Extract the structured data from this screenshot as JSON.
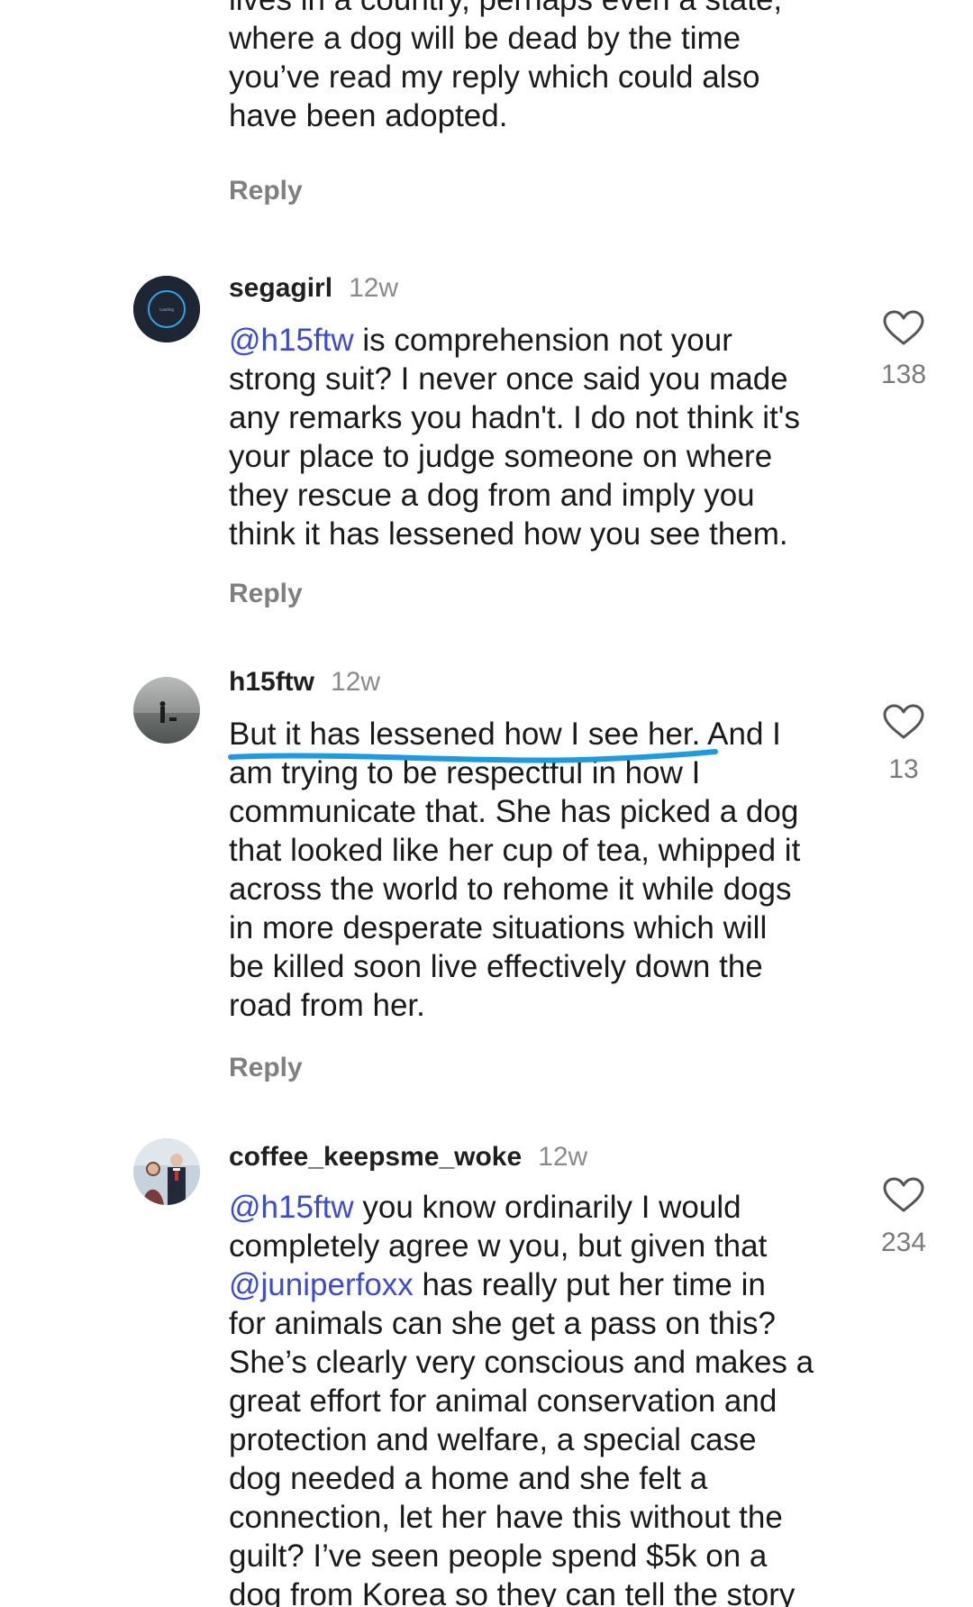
{
  "comments": [
    {
      "lines": [
        [
          {
            "t": "lives in a country, perhaps even a state,"
          }
        ],
        [
          {
            "t": "where a dog will be dead by the time"
          }
        ],
        [
          {
            "t": "you’ve read my reply which could also"
          }
        ],
        [
          {
            "t": "have been adopted."
          }
        ]
      ],
      "reply": "Reply"
    },
    {
      "user": "segagirl",
      "time": "12w",
      "avatar_icon": "loading-avatar-icon",
      "likes": "138",
      "lines": [
        [
          {
            "t": "@h15ftw",
            "m": true
          },
          {
            "t": " is comprehension not your"
          }
        ],
        [
          {
            "t": "strong suit? I never once said you made"
          }
        ],
        [
          {
            "t": "any remarks you hadn't. I do not think it's"
          }
        ],
        [
          {
            "t": "your place to judge someone on where"
          }
        ],
        [
          {
            "t": "they rescue a dog from and imply you"
          }
        ],
        [
          {
            "t": "think it has lessened how you see them."
          }
        ]
      ],
      "reply": "Reply"
    },
    {
      "user": "h15ftw",
      "time": "12w",
      "avatar_icon": "beach-silhouette-avatar",
      "likes": "13",
      "lines": [
        [
          {
            "t": "But it has lessened how I see her. And I"
          }
        ],
        [
          {
            "t": "am trying to be respectful in how I"
          }
        ],
        [
          {
            "t": "communicate that. She has picked a dog"
          }
        ],
        [
          {
            "t": "that looked like her cup of tea, whipped it"
          }
        ],
        [
          {
            "t": "across the world to rehome it while dogs"
          }
        ],
        [
          {
            "t": "in more desperate situations which will"
          }
        ],
        [
          {
            "t": "be killed soon live effectively down the"
          }
        ],
        [
          {
            "t": "road from her."
          }
        ]
      ],
      "reply": "Reply"
    },
    {
      "user": "coffee_keepsme_woke",
      "time": "12w",
      "avatar_icon": "couple-photo-avatar",
      "likes": "234",
      "lines": [
        [
          {
            "t": "@h15ftw",
            "m": true
          },
          {
            "t": " you know ordinarily I would"
          }
        ],
        [
          {
            "t": "completely agree w you, but given that"
          }
        ],
        [
          {
            "t": "@juniperfoxx",
            "m": true
          },
          {
            "t": " has really put her time in"
          }
        ],
        [
          {
            "t": "for animals can she get a pass on this?"
          }
        ],
        [
          {
            "t": "She’s clearly very conscious and makes a"
          }
        ],
        [
          {
            "t": "great effort for animal conservation and"
          }
        ],
        [
          {
            "t": "protection and welfare, a special case"
          }
        ],
        [
          {
            "t": "dog needed a home and she felt a"
          }
        ],
        [
          {
            "t": "connection, let her have this without the"
          }
        ],
        [
          {
            "t": "guilt? I’ve seen people spend $5k on a"
          }
        ],
        [
          {
            "t": "dog from Korea so they can tell the story"
          }
        ]
      ]
    }
  ],
  "colors": {
    "mention": "#3b4bd6",
    "highlight_underline": "#1a9be6",
    "muted": "#7f7f7f"
  },
  "icons": {
    "like": "heart-outline-icon"
  }
}
